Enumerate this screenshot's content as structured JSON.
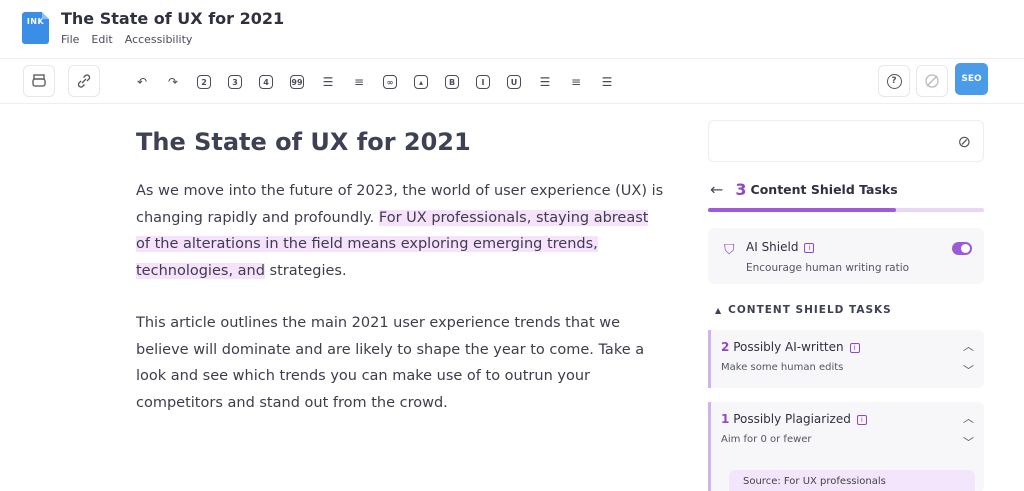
{
  "app": {
    "logo_text": "INK",
    "doc_title": "The State of UX for 2021",
    "menus": [
      "File",
      "Edit",
      "Accessibility"
    ]
  },
  "toolbar": {
    "icons": [
      "undo-icon",
      "redo-icon",
      "heading-2-icon",
      "heading-3-icon",
      "heading-4-icon",
      "quote-icon",
      "bullet-list-icon",
      "numbered-list-icon",
      "link-icon",
      "image-icon",
      "bold-icon",
      "italic-icon",
      "underline-icon",
      "align-left-icon",
      "align-center-icon",
      "align-justify-icon"
    ],
    "h2": "2",
    "h3": "3",
    "h4": "4",
    "quote": "99",
    "bold": "B",
    "italic": "I",
    "underline": "U",
    "seo_label": "SEO"
  },
  "editor": {
    "heading": "The State of UX for 2021",
    "para1_a": "As we move into the future of 2023, the world of user experience (UX) is changing rapidly and profoundly. ",
    "para1_hl": "For UX professionals, staying abreast of the alterations in the field means exploring emerging trends, technologies, and",
    "para1_b": " strategies.",
    "para2": "This article outlines the main 2021 user experience trends that we believe will dominate and are likely to shape the year to come. Take a look and see which trends you can make use of to outrun your competitors and stand out from the crowd."
  },
  "panel": {
    "tasks_count": "3",
    "tasks_label": "Content Shield Tasks",
    "progress_fraction": 0.68,
    "ai_shield_title": "AI Shield",
    "ai_shield_sub": "Encourage human writing ratio",
    "ai_shield_on": true,
    "section_title": "CONTENT SHIELD TASKS",
    "tasks": [
      {
        "count": "2",
        "title": "Possibly AI-written",
        "sub": "Make some human edits"
      },
      {
        "count": "1",
        "title": "Possibly Plagiarized",
        "sub": "Aim for 0 or fewer"
      }
    ],
    "source_text": "Source: For UX professionals"
  },
  "colors": {
    "accent_purple": "#8f48cc",
    "highlight": "#f6e2fb",
    "seo_blue": "#4a9be8",
    "logo_blue": "#3a8ee6"
  }
}
